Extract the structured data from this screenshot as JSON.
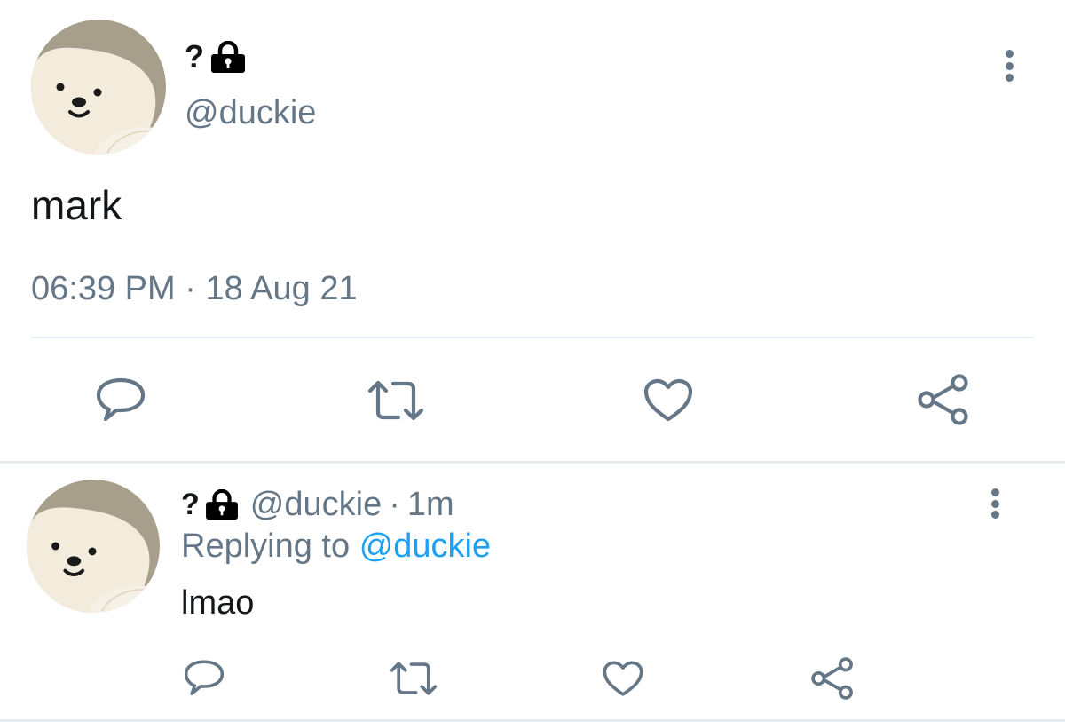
{
  "tweet": {
    "display_name": "?",
    "lock_icon": "lock-icon",
    "handle": "@duckie",
    "text": "mark",
    "time": "06:39 PM",
    "separator": "·",
    "date": "18 Aug 21",
    "more_icon": "more-vertical-icon",
    "actions": {
      "reply_icon": "reply-icon",
      "retweet_icon": "retweet-icon",
      "like_icon": "heart-icon",
      "share_icon": "share-icon"
    }
  },
  "reply": {
    "display_name": "?",
    "lock_icon": "lock-icon",
    "handle": "@duckie",
    "separator": "·",
    "time_ago": "1m",
    "replying_prefix": "Replying to",
    "replying_to": "@duckie",
    "text": "lmao",
    "more_icon": "more-vertical-icon",
    "actions": {
      "reply_icon": "reply-icon",
      "retweet_icon": "retweet-icon",
      "like_icon": "heart-icon",
      "share_icon": "share-icon"
    }
  },
  "colors": {
    "text_primary": "#14171a",
    "text_secondary": "#657786",
    "link": "#1da1f2",
    "divider": "#e6ecf0",
    "avatar_bg": "#a89e8c",
    "avatar_face": "#f3ecdd"
  }
}
